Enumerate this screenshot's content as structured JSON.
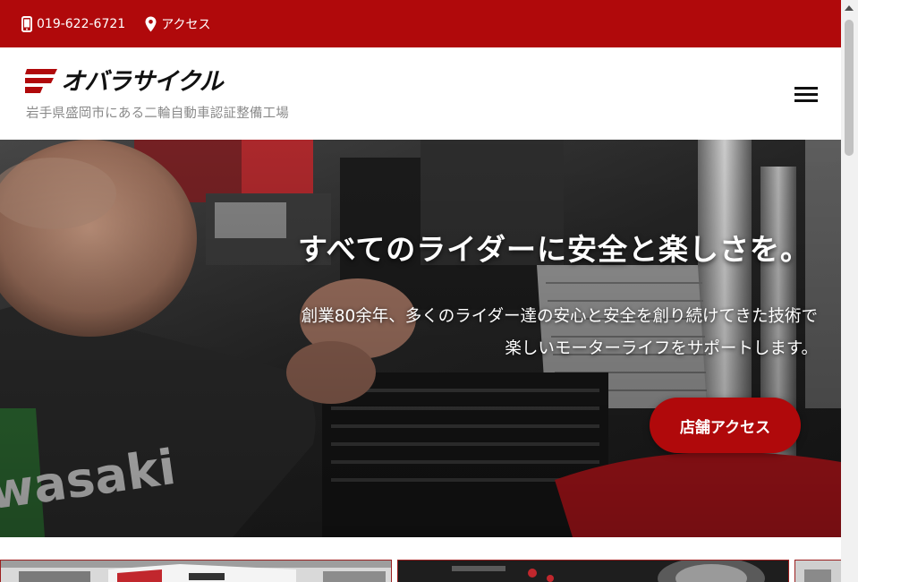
{
  "topbar": {
    "phone": "019-622-6721",
    "access": "アクセス",
    "phone_icon": "smartphone-icon",
    "access_icon": "map-pin-icon",
    "bg_color": "#b0090b"
  },
  "header": {
    "logo_text": "オバラサイクル",
    "tagline": "岩手県盛岡市にある二輪自動車認証整備工場",
    "menu_icon": "hamburger-menu-icon"
  },
  "hero": {
    "title": "すべてのライダーに安全と楽しさを。",
    "subtitle_line1": "創業80余年、多くのライダー達の安心と安全を創り続けてきた技術で",
    "subtitle_line2": "楽しいモーターライフをサポートします。",
    "button_label": "店舗アクセス",
    "accent_color": "#b0090b"
  }
}
